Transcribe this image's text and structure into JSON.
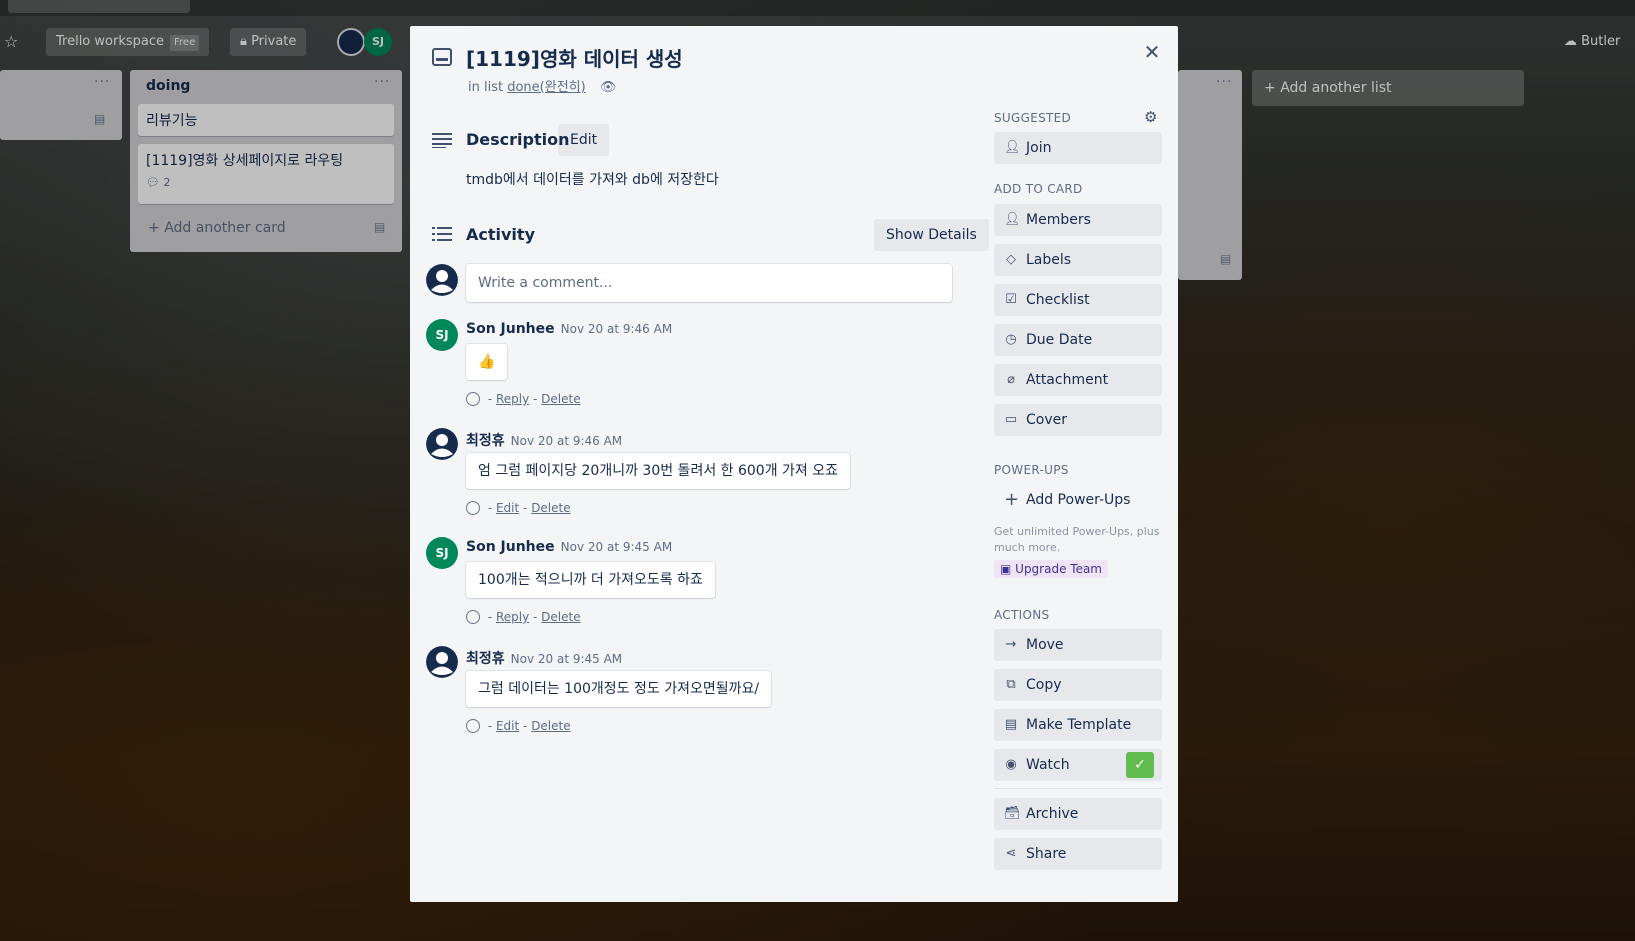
{
  "board": {
    "workspace_label": "Trello workspace",
    "workspace_badge": "Free",
    "privacy_label": "Private",
    "member_initials": "SJ",
    "butler_label": "Butler",
    "add_list_label": "Add another list",
    "list_doing": {
      "title": "doing",
      "cards": [
        {
          "title": "리뷰기능"
        },
        {
          "title": "[1119]영화 상세페이지로 라우팅",
          "comment_count": "2"
        }
      ],
      "add_card_label": "Add another card"
    }
  },
  "card": {
    "title": "[1119]영화 데이터 생성",
    "in_list_prefix": "in list",
    "list_name": "done(완전히)",
    "description_heading": "Description",
    "description_edit_label": "Edit",
    "description_text": "tmdb에서 데이터를 가져와 db에 저장한다",
    "activity_heading": "Activity",
    "show_details_label": "Show Details",
    "comment_placeholder": "Write a comment...",
    "comments": [
      {
        "author": "Son Junhee",
        "initials": "SJ",
        "time": "Nov 20 at 9:46 AM",
        "text": "👍",
        "actions": [
          "Reply",
          "Delete"
        ]
      },
      {
        "author": "최정휴",
        "time": "Nov 20 at 9:46 AM",
        "text": "엄 그럼 페이지당 20개니까 30번 돌려서 한 600개 가져 오죠",
        "actions": [
          "Edit",
          "Delete"
        ]
      },
      {
        "author": "Son Junhee",
        "initials": "SJ",
        "time": "Nov 20 at 9:45 AM",
        "text": "100개는 적으니까 더 가져오도록 하죠",
        "actions": [
          "Reply",
          "Delete"
        ]
      },
      {
        "author": "최정휴",
        "time": "Nov 20 at 9:45 AM",
        "text": "그럼 데이터는 100개정도 정도 가져오면될까요/",
        "actions": [
          "Edit",
          "Delete"
        ]
      }
    ]
  },
  "sidebar": {
    "suggested_heading": "SUGGESTED",
    "join_label": "Join",
    "add_to_card_heading": "ADD TO CARD",
    "add_to_card": [
      "Members",
      "Labels",
      "Checklist",
      "Due Date",
      "Attachment",
      "Cover"
    ],
    "powerups_heading": "POWER-UPS",
    "add_powerups_label": "Add Power-Ups",
    "powerups_note": "Get unlimited Power-Ups, plus much more.",
    "upgrade_label": "Upgrade Team",
    "actions_heading": "ACTIONS",
    "actions": [
      "Move",
      "Copy",
      "Make Template",
      "Watch"
    ],
    "more_actions": [
      "Archive",
      "Share"
    ]
  },
  "colors": {
    "accent_green": "#61bd4f",
    "avatar_green": "#00875a",
    "avatar_dark": "#172b4d"
  }
}
